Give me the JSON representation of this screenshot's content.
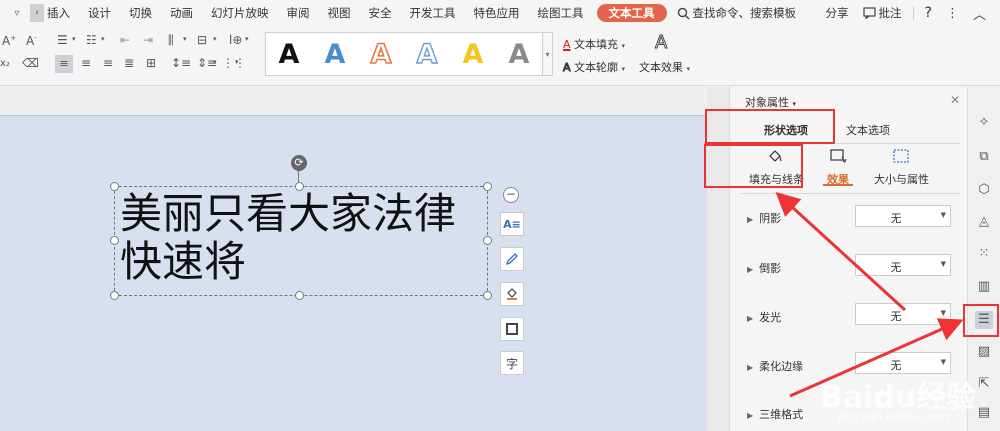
{
  "menubar": {
    "tabs": [
      "插入",
      "设计",
      "切换",
      "动画",
      "幻灯片放映",
      "审阅",
      "视图",
      "安全",
      "开发工具",
      "特色应用",
      "绘图工具",
      "文本工具"
    ],
    "active_tab": "文本工具",
    "search": "查找命令、搜索模板",
    "share": "分享",
    "comment": "批注",
    "help": "?",
    "more": "⋮",
    "collapse": "^"
  },
  "ribbon": {
    "text_fill": "文本填充",
    "text_outline": "文本轮廓",
    "text_effect": "文本效果",
    "wordart_glyph": "A",
    "wordart_colors": [
      "#111111",
      "#4a8bd6",
      "#e07a47",
      "#ffffff",
      "#f5c518",
      "#8a8a8a"
    ]
  },
  "slide": {
    "text_line1": "美丽只看大家法律",
    "text_line2": "快速将"
  },
  "panel": {
    "title": "对象属性",
    "tab_shape": "形状选项",
    "tab_text": "文本选项",
    "sub_fill": "填充与线条",
    "sub_effect": "效果",
    "sub_size": "大小与属性",
    "rows": [
      {
        "label": "阴影",
        "value": "无"
      },
      {
        "label": "倒影",
        "value": "无"
      },
      {
        "label": "发光",
        "value": "无"
      },
      {
        "label": "柔化边缘",
        "value": "无"
      },
      {
        "label": "三维格式",
        "value": ""
      }
    ]
  },
  "watermark": {
    "brand": "Baidu经验",
    "url": "jingyan.baidu.com"
  },
  "colors": {
    "accent": "#e06b2a",
    "active_tab_bg": "#e0654a",
    "annotation": "#e33333",
    "slide_bg": "#d8e0f0"
  }
}
